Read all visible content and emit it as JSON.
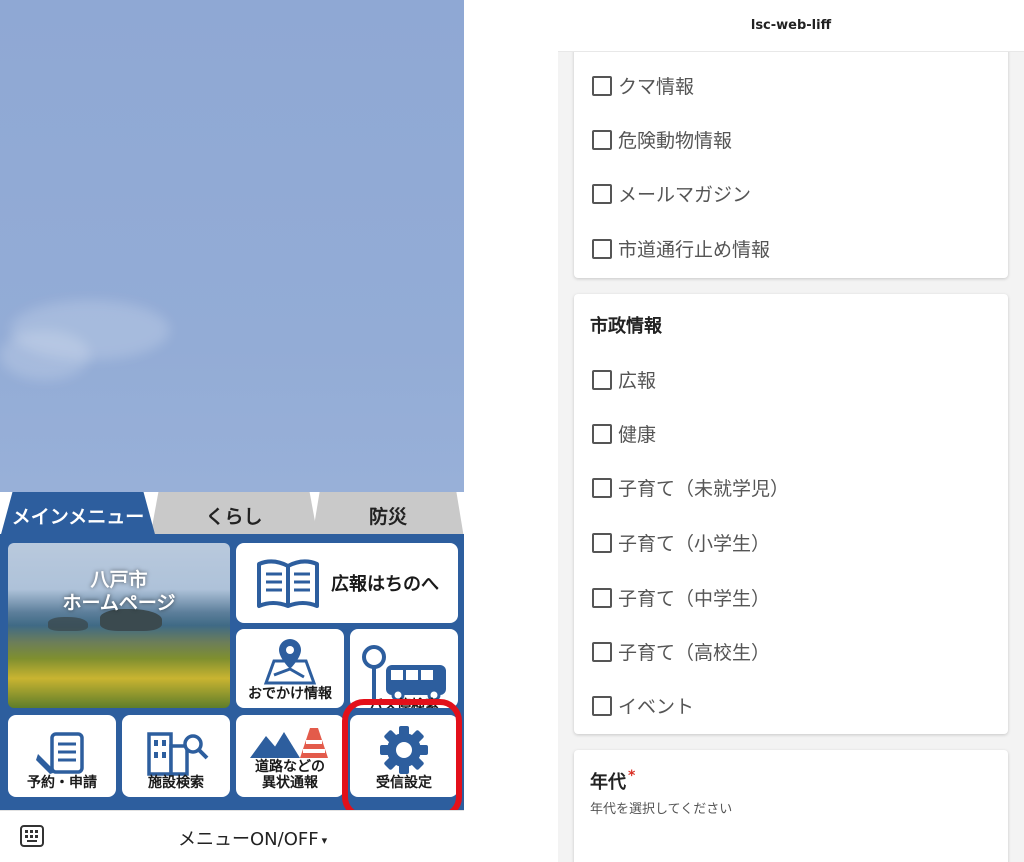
{
  "left": {
    "tabs": [
      {
        "label": "メインメニュー",
        "active": true
      },
      {
        "label": "くらし",
        "active": false
      },
      {
        "label": "防災",
        "active": false
      }
    ],
    "tiles": {
      "homepage": "八戸市\nホームページ",
      "kouhou": "広報はちのへ",
      "odekake": "おでかけ情報",
      "bus": "バス停検索",
      "yoyaku": "予約・申請",
      "shisetsu": "施設検索",
      "douro_line1": "道路などの",
      "douro_line2": "異状通報",
      "jushin": "受信設定"
    },
    "bottom_bar": {
      "menu_toggle": "メニューON/OFF",
      "arrow": "▾",
      "keyboard_icon": "keyboard-icon"
    },
    "colors": {
      "brand_blue": "#2d5e9e",
      "highlight_red": "#e3101a"
    }
  },
  "right": {
    "header_title": "lsc-web-liff",
    "card1_options": [
      "クマ情報",
      "危険動物情報",
      "メールマガジン",
      "市道通行止め情報"
    ],
    "card2": {
      "title": "市政情報",
      "options": [
        "広報",
        "健康",
        "子育て（未就学児）",
        "子育て（小学生）",
        "子育て（中学生）",
        "子育て（高校生）",
        "イベント"
      ]
    },
    "card3": {
      "title": "年代",
      "required_mark": "*",
      "subtitle": "年代を選択してください"
    }
  }
}
